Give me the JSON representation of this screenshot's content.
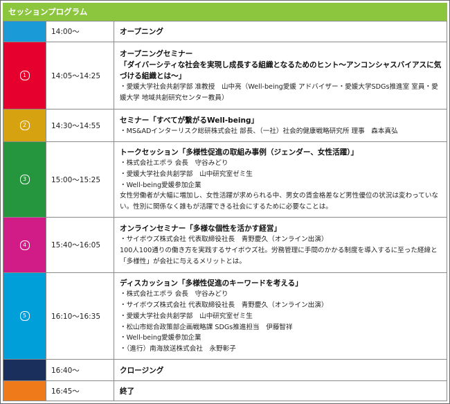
{
  "header": {
    "title": "セッションプログラム"
  },
  "colors": {
    "header_green": "#8cc63e",
    "border": "#8a8a8a"
  },
  "rows": [
    {
      "mark": "",
      "color": "#1a9bd7",
      "time": "14:00〜",
      "title": "オープニング",
      "lines": []
    },
    {
      "mark": "1",
      "color": "#e5002d",
      "time": "14:05〜14:25",
      "title": "オープニングセミナー",
      "title2": "「ダイバーシティな社会を実現し成長する組織となるためのヒント〜アンコンシャスバイアスに気づける組織とは〜」",
      "lines": [
        "・愛媛大学社会共創学部 准教授　山中亮（Well-being愛媛 アドバイザー・愛媛大学SDGs推進室 室員・愛媛大学 地域共創研究センター教員）"
      ]
    },
    {
      "mark": "2",
      "color": "#d7a20f",
      "time": "14:30〜14:55",
      "title": "セミナー「すべてが繋がるWell-being」",
      "lines": [
        "・MS&ADインターリスク総研株式会社 部長、（一社）社会的健康戦略研究所 理事　森本真弘"
      ]
    },
    {
      "mark": "3",
      "color": "#25963e",
      "time": "15:00〜15:25",
      "title": "トークセッション「多様性促進の取組み事例（ジェンダー、女性活躍）」",
      "lines": [
        "・株式会社エポラ 会長　守谷みどり",
        "・愛媛大学社会共創学部　山中研究室ゼミ生",
        "・Well-being愛媛参加企業",
        "女性労働者が大幅に増加し、女性活躍が求められる中、男女の賃金格差など男性優位の状況は変わっていない。性別に関係なく誰もが活躍できる社会にするために必要なことは。"
      ]
    },
    {
      "mark": "4",
      "color": "#d11b87",
      "time": "15:40〜16:05",
      "title": "オンラインセミナー「多様な個性を活かす経営」",
      "lines": [
        "・サイボウズ株式会社 代表取締役社長　青野慶久（オンライン出演）",
        "100人100通りの働き方を実践するサイボウズ社。労務管理に手間のかかる制度を導入するに至った経緯と「多様性」が会社に与えるメリットとは。"
      ]
    },
    {
      "mark": "5",
      "color": "#009fd9",
      "time": "16:10〜16:35",
      "title": "ディスカッション「多様性促進のキーワードを考える」",
      "lines": [
        "・株式会社エポラ 会長　守谷みどり",
        "・サイボウズ株式会社 代表取締役社長　青野慶久（オンライン出演）",
        "・愛媛大学社会共創学部　山中研究室ゼミ生",
        "・松山市総合政策部企画戦略課 SDGs推進担当　伊藤智祥",
        "・Well-being愛媛参加企業",
        "・（進行）南海放送株式会社　永野彰子"
      ]
    },
    {
      "mark": "",
      "color": "#1b2f5c",
      "time": "16:40〜",
      "title": "クロージング",
      "lines": []
    },
    {
      "mark": "",
      "color": "#ee7a1a",
      "time": "16:45〜",
      "title": "終了",
      "lines": []
    }
  ]
}
